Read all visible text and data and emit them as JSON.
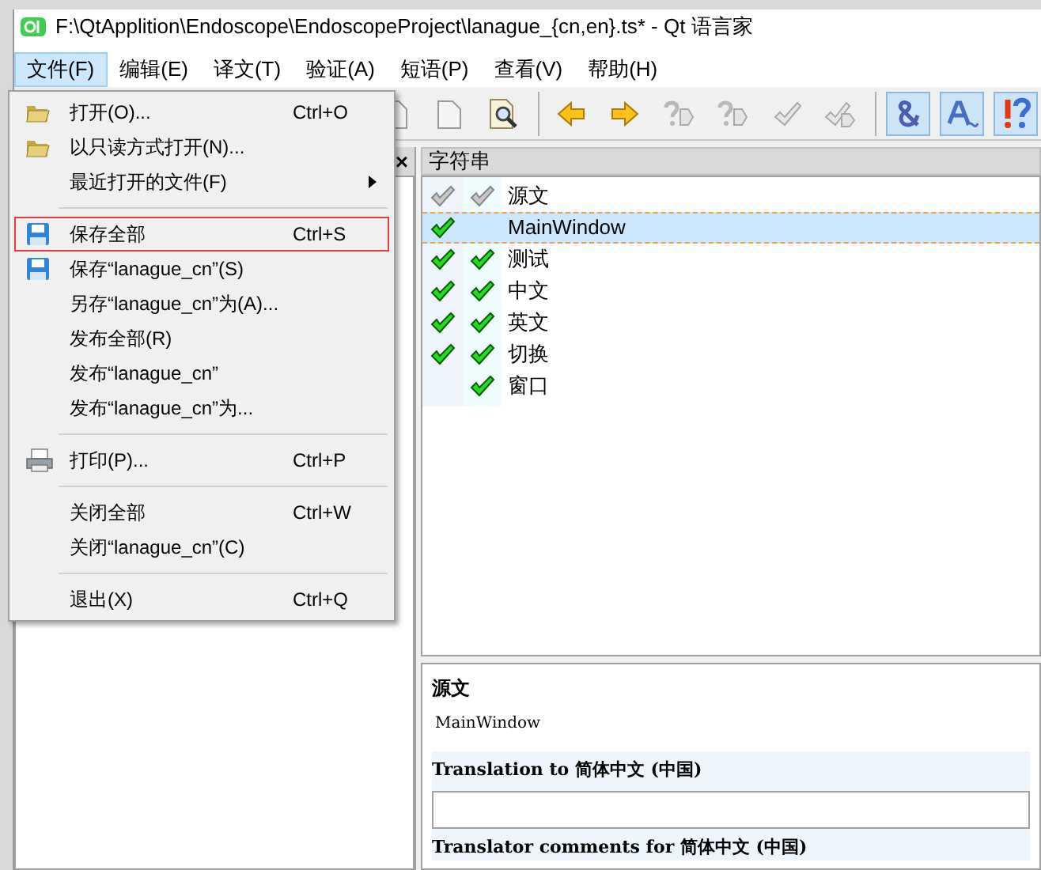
{
  "window": {
    "title": "F:\\QtApplition\\Endoscope\\EndoscopeProject\\lanague_{cn,en}.ts* - Qt 语言家"
  },
  "menu_bar": [
    {
      "label": "文件(F)",
      "selected": true
    },
    {
      "label": "编辑(E)",
      "selected": false
    },
    {
      "label": "译文(T)",
      "selected": false
    },
    {
      "label": "验证(A)",
      "selected": false
    },
    {
      "label": "短语(P)",
      "selected": false
    },
    {
      "label": "查看(V)",
      "selected": false
    },
    {
      "label": "帮助(H)",
      "selected": false
    }
  ],
  "toolbar": [
    {
      "buttons": [
        {
          "kind": "doc",
          "on": false
        },
        {
          "kind": "doc",
          "on": false
        },
        {
          "kind": "find",
          "on": false
        }
      ]
    },
    {
      "buttons": [
        {
          "kind": "prev",
          "on": false
        },
        {
          "kind": "next",
          "on": false
        },
        {
          "kind": "prevq",
          "on": false
        },
        {
          "kind": "nextq",
          "on": false
        },
        {
          "kind": "done",
          "on": false
        },
        {
          "kind": "donenext",
          "on": false
        }
      ]
    },
    {
      "buttons": [
        {
          "kind": "amp",
          "on": true
        },
        {
          "kind": "accel",
          "on": true
        },
        {
          "kind": "warn",
          "on": true
        }
      ]
    }
  ],
  "file_menu": [
    {
      "kind": "open",
      "label": "打开(O)...",
      "shortcut": "Ctrl+O",
      "highlighted": false
    },
    {
      "kind": "open",
      "label": "以只读方式打开(N)...",
      "highlighted": false
    },
    {
      "kind": "submenu",
      "label": "最近打开的文件(F)",
      "highlighted": false
    },
    {
      "kind": "separator"
    },
    {
      "kind": "save",
      "label": "保存全部",
      "shortcut": "Ctrl+S",
      "highlighted": true
    },
    {
      "kind": "save",
      "label": "保存“lanague_cn”(S)",
      "highlighted": false
    },
    {
      "kind": "item",
      "label": "另存“lanague_cn”为(A)...",
      "highlighted": false
    },
    {
      "kind": "item",
      "label": "发布全部(R)",
      "highlighted": false
    },
    {
      "kind": "item",
      "label": "发布“lanague_cn”",
      "highlighted": false
    },
    {
      "kind": "item",
      "label": "发布“lanague_cn”为...",
      "highlighted": false
    },
    {
      "kind": "separator"
    },
    {
      "kind": "print",
      "label": "打印(P)...",
      "shortcut": "Ctrl+P",
      "highlighted": false
    },
    {
      "kind": "separator"
    },
    {
      "kind": "item",
      "label": "关闭全部",
      "shortcut": "Ctrl+W",
      "highlighted": false
    },
    {
      "kind": "item",
      "label": "关闭“lanague_cn”(C)",
      "highlighted": false
    },
    {
      "kind": "separator"
    },
    {
      "kind": "item",
      "label": "退出(X)",
      "shortcut": "Ctrl+Q",
      "highlighted": false
    }
  ],
  "left_panel": {
    "close": "×"
  },
  "strings_panel": {
    "title": "字符串",
    "rows": [
      {
        "kind": "header",
        "checked_1": true,
        "checked_2": true,
        "text": "源文",
        "selected": false
      },
      {
        "kind": "message",
        "checked_1": true,
        "checked_2": false,
        "text": "MainWindow",
        "selected": true
      },
      {
        "kind": "message",
        "checked_1": true,
        "checked_2": true,
        "text": "测试",
        "selected": false
      },
      {
        "kind": "message",
        "checked_1": true,
        "checked_2": true,
        "text": "中文",
        "selected": false
      },
      {
        "kind": "message",
        "checked_1": true,
        "checked_2": true,
        "text": "英文",
        "selected": false
      },
      {
        "kind": "message",
        "checked_1": true,
        "checked_2": true,
        "text": "切换",
        "selected": false
      },
      {
        "kind": "message",
        "checked_1": false,
        "checked_2": true,
        "text": "窗口",
        "selected": false
      }
    ]
  },
  "editor": {
    "source_label": "源文",
    "source_text": "MainWindow",
    "translation_label": "Translation to 简体中文 (中国)",
    "comments_label": "Translator comments for 简体中文 (中国)"
  }
}
